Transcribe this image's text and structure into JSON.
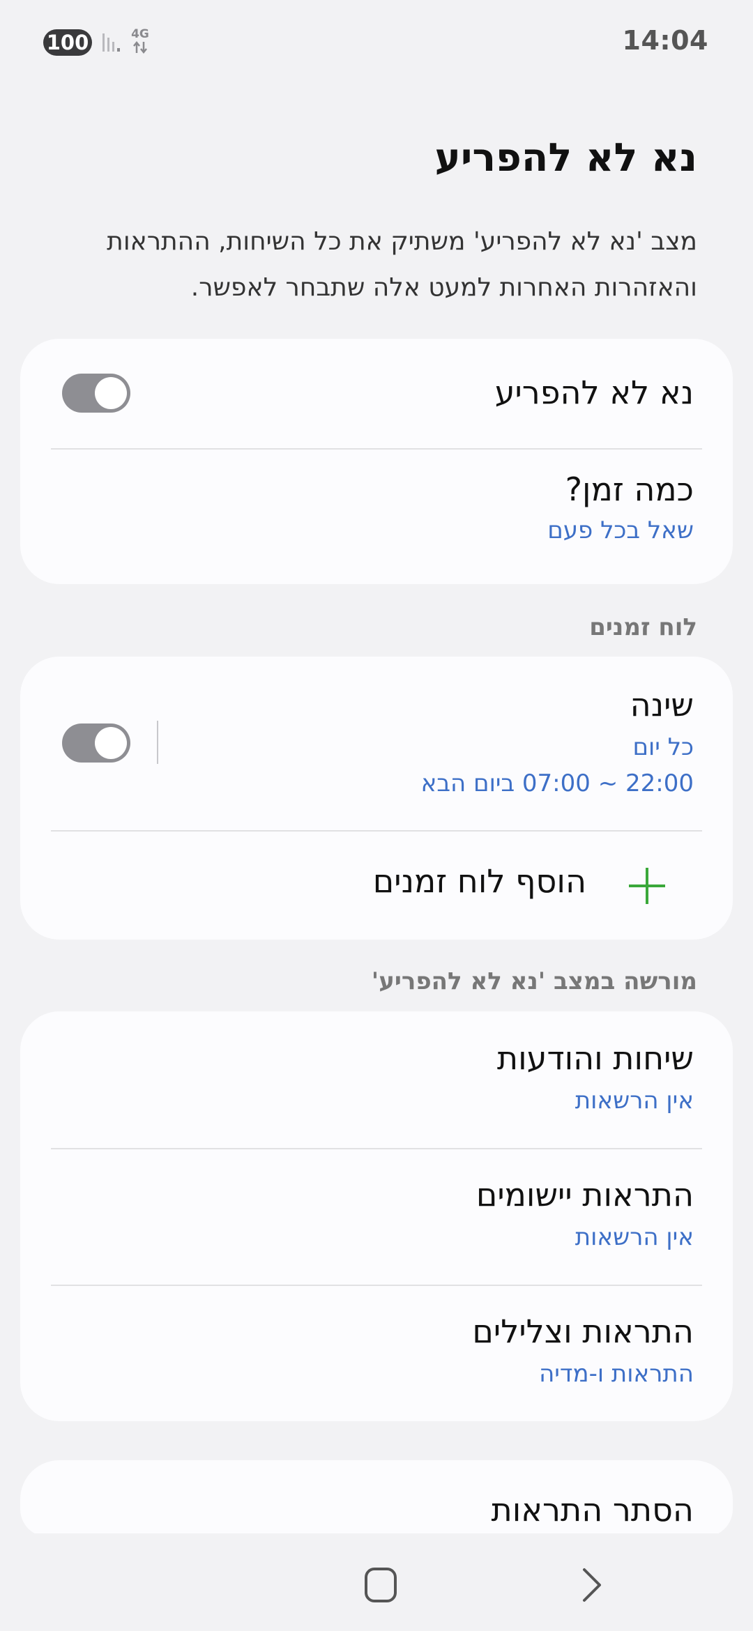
{
  "status_bar": {
    "battery": "100",
    "network": "4G",
    "time": "14:04"
  },
  "header": {
    "title": "נא לא להפריע",
    "description": "מצב 'נא לא להפריע' משתיק את כל השיחות, ההתראות והאזהרות האחרות למעט אלה שתבחר לאפשר."
  },
  "main_card": {
    "dnd_label": "נא לא להפריע",
    "dnd_enabled": false,
    "duration_label": "כמה זמן?",
    "duration_value": "שאל בכל פעם"
  },
  "schedules": {
    "section_label": "לוח זמנים",
    "items": [
      {
        "name": "שינה",
        "days": "כל יום",
        "time_range": "22:00 ~ 07:00 ביום הבא",
        "enabled": false
      }
    ],
    "add_label": "הוסף לוח זמנים"
  },
  "allowed": {
    "section_label": "מורשה במצב 'נא לא להפריע'",
    "items": [
      {
        "title": "שיחות והודעות",
        "value": "אין הרשאות"
      },
      {
        "title": "התראות יישומים",
        "value": "אין הרשאות"
      },
      {
        "title": "התראות וצלילים",
        "value": "התראות ו-מדיה"
      }
    ]
  },
  "hide_notifications": {
    "title": "הסתר התראות"
  },
  "colors": {
    "accent_blue": "#3d6fc7",
    "add_green": "#3aa83a",
    "toggle_off": "#8e8e93"
  },
  "icons": {
    "add": "plus-icon",
    "home": "home-icon",
    "back": "back-icon"
  }
}
